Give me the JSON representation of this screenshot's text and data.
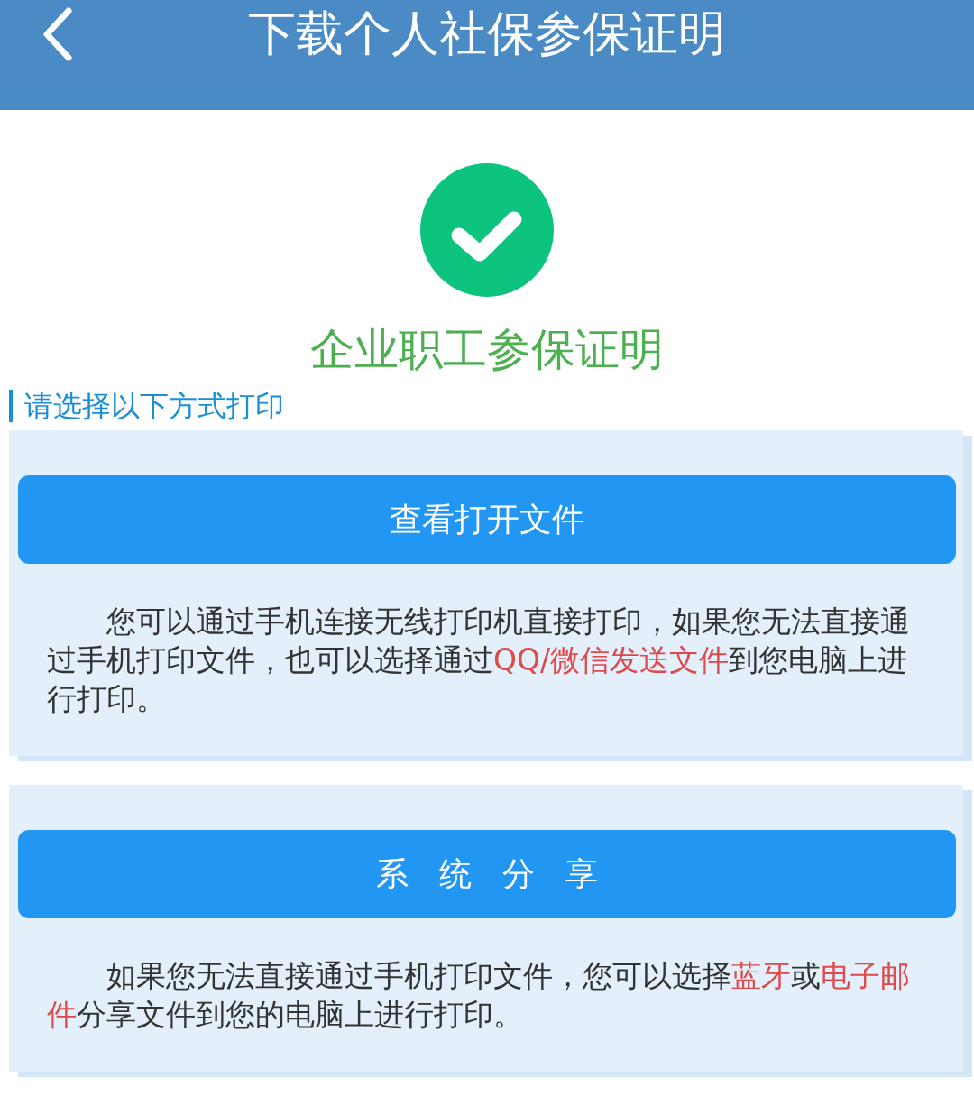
{
  "header": {
    "title": "下载个人社保参保证明"
  },
  "result": {
    "title": "企业职工参保证明"
  },
  "section": {
    "title": "请选择以下方式打印"
  },
  "options": [
    {
      "button": "查看打开文件",
      "description": [
        {
          "text": "您可以通过手机连接无线打印机直接打印，如果您无法直接通过手机打印文件，也可以选择通过",
          "highlighted": false
        },
        {
          "text": "QQ/微信发送文件",
          "highlighted": true
        },
        {
          "text": "到您电脑上进行打印。",
          "highlighted": false
        }
      ]
    },
    {
      "button": "系 统 分 享",
      "description": [
        {
          "text": "如果您无法直接通过手机打印文件，您可以选择",
          "highlighted": false
        },
        {
          "text": "蓝牙",
          "highlighted": true
        },
        {
          "text": "或",
          "highlighted": false
        },
        {
          "text": "电子邮件",
          "highlighted": true
        },
        {
          "text": "分享文件到您的电脑上进行打印。",
          "highlighted": false
        }
      ]
    }
  ]
}
